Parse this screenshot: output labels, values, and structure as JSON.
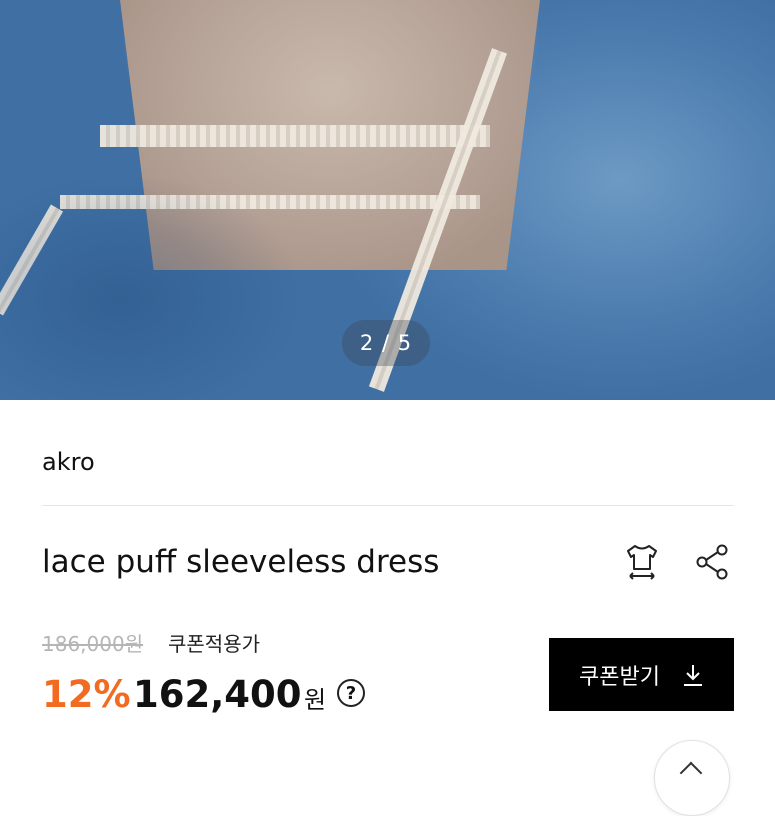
{
  "gallery": {
    "counter": "2 / 5"
  },
  "product": {
    "brand": "akro",
    "title": "lace puff sleeveless dress",
    "original_price": "186,000원",
    "coupon_label": "쿠폰적용가",
    "discount": "12%",
    "price": "162,400",
    "currency": "원",
    "help": "?"
  },
  "actions": {
    "size_icon": "tshirt-size-icon",
    "share_icon": "share-icon",
    "coupon_button_label": "쿠폰받기",
    "coupon_icon": "download-icon",
    "fab_icon": "chevron-up-icon"
  },
  "colors": {
    "accent": "#f26b21",
    "button_bg": "#000000",
    "strikethrough": "#b5b5b5"
  }
}
